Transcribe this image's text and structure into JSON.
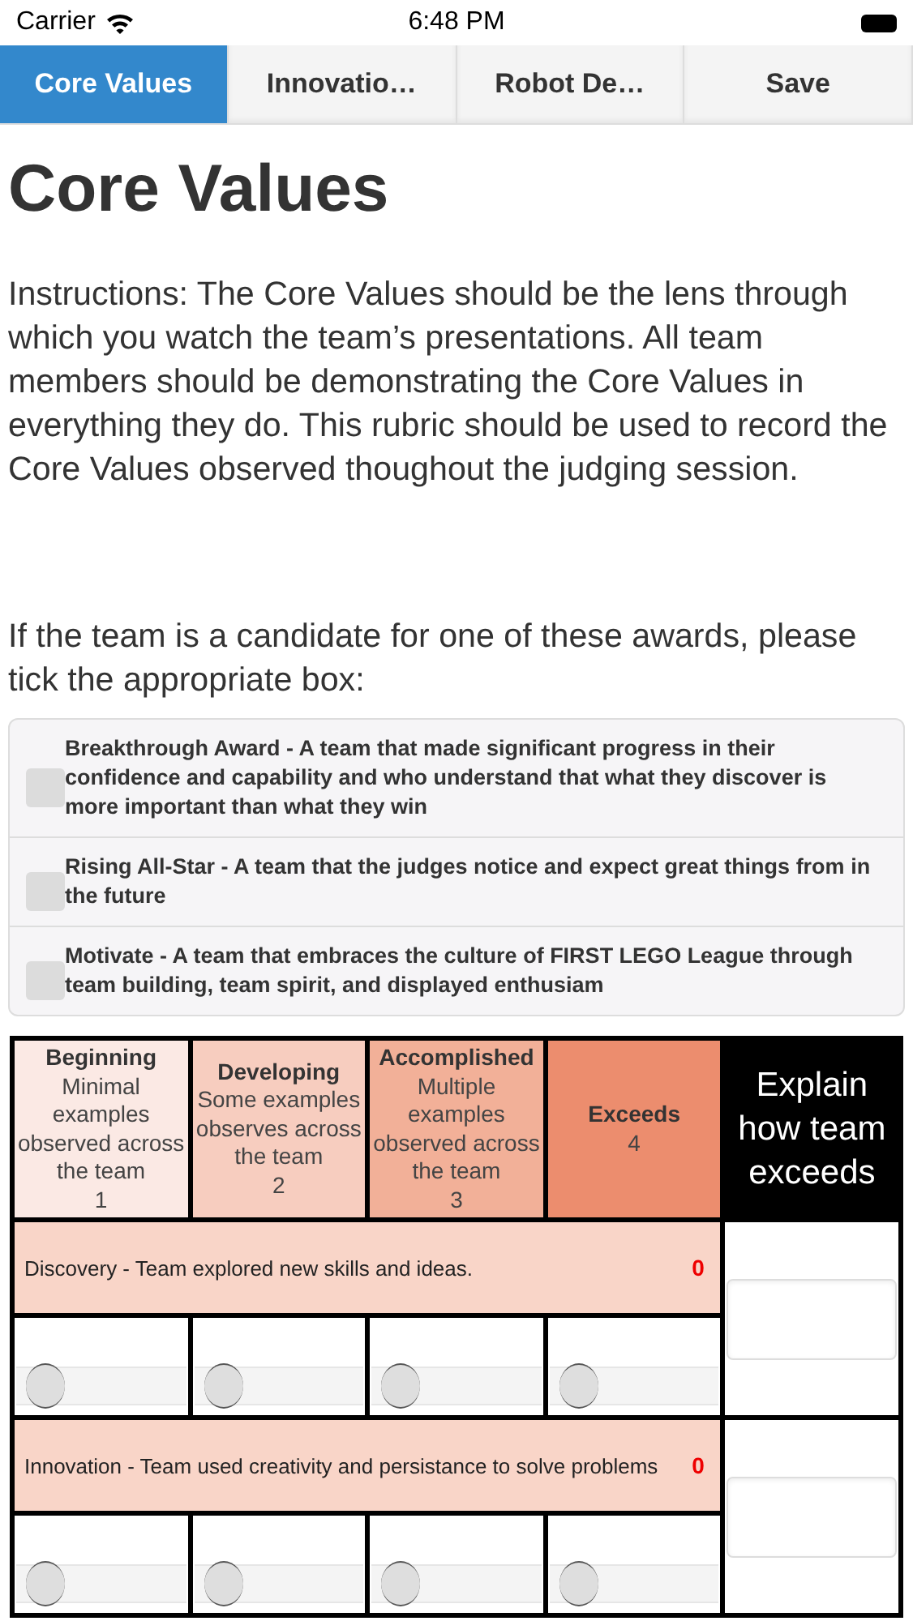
{
  "status_bar": {
    "carrier": "Carrier",
    "time": "6:48 PM"
  },
  "tabs": [
    {
      "label": "Core Values",
      "selected": true
    },
    {
      "label": "Innovatio…",
      "selected": false
    },
    {
      "label": "Robot De…",
      "selected": false
    },
    {
      "label": "Save",
      "selected": false
    }
  ],
  "title": "Core Values",
  "instructions": "Instructions: The Core Values should be the lens through which you watch the team’s presentations. All team members should be demonstrating the Core Values in everything they do. This rubric should be used to record the Core Values observed thoughout the judging session.",
  "awards_prompt": "If the team is a candidate for one of these awards, please tick the appropriate box:",
  "awards": [
    {
      "label": "Breakthrough Award - A team that made significant progress in their confidence and capability and who understand that what they discover is more important than what they win",
      "checked": false
    },
    {
      "label": "Rising All-Star - A team that the judges notice and expect great things from in the future",
      "checked": false
    },
    {
      "label": "Motivate - A team that embraces the culture of FIRST LEGO League through team building, team spirit, and displayed enthusiam",
      "checked": false
    }
  ],
  "rubric": {
    "levels": [
      {
        "name": "Beginning",
        "description": "Minimal examples observed across the team",
        "score": "1",
        "color": "#fbe9e4"
      },
      {
        "name": "Developing",
        "description": "Some examples observes across the team",
        "score": "2",
        "color": "#f7cdbf"
      },
      {
        "name": "Accomplished",
        "description": "Multiple examples observed across the team",
        "score": "3",
        "color": "#f2b098"
      },
      {
        "name": "Exceeds",
        "score": "4",
        "color": "#ec8d6e"
      }
    ],
    "explain_header": "Explain how team exceeds",
    "criteria": [
      {
        "label": "Discovery - Team explored new skills and ideas.",
        "score": "0",
        "options": [
          {
            "selected": false
          },
          {
            "selected": false
          },
          {
            "selected": false
          },
          {
            "selected": false
          }
        ]
      },
      {
        "label": "Innovation - Team used creativity and persistance to solve problems",
        "score": "0",
        "options": [
          {
            "selected": false
          },
          {
            "selected": false
          },
          {
            "selected": false
          },
          {
            "selected": false
          }
        ]
      }
    ]
  }
}
